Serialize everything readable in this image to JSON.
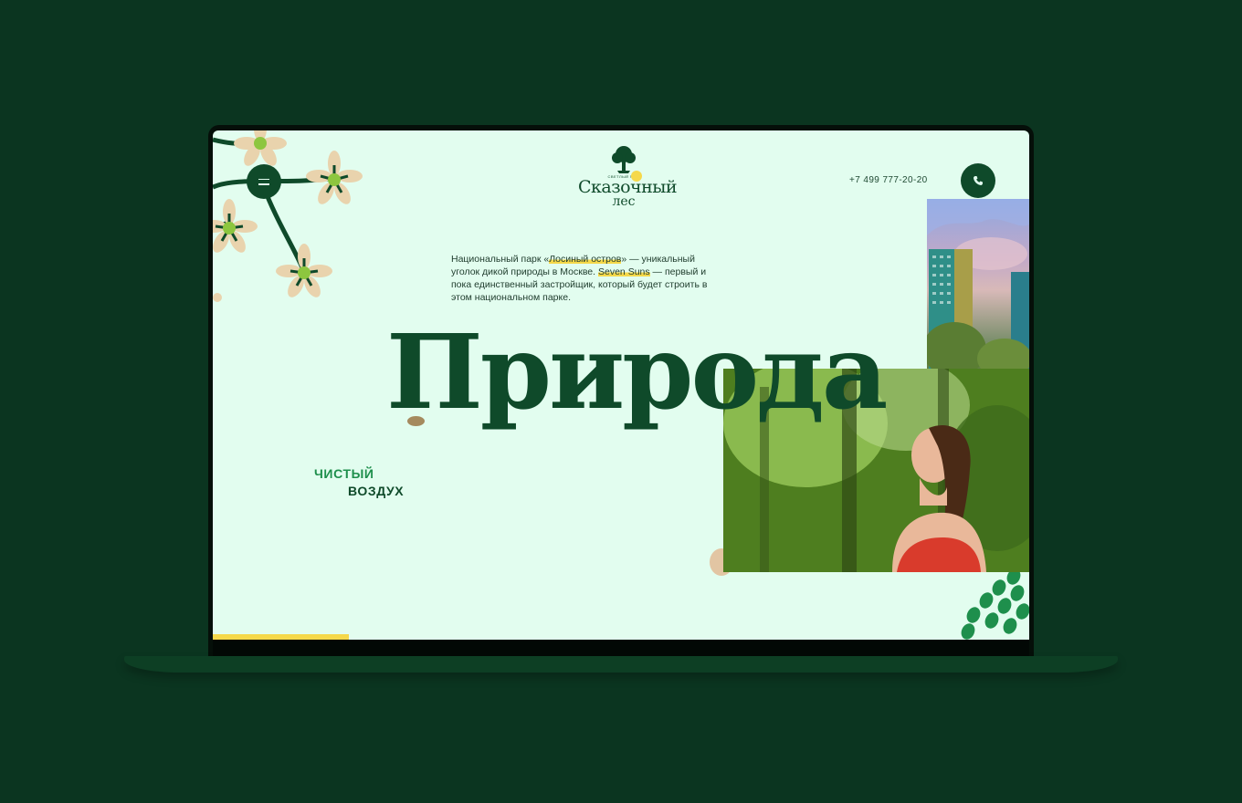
{
  "brand": {
    "logo_small": "СВЕТЛЫЙ МИР",
    "logo_main": "Сказочный",
    "logo_sub": "лес"
  },
  "header": {
    "phone": "+7 499 777-20-20"
  },
  "intro": {
    "part1": "Национальный парк «",
    "link1": "Лосиный остров",
    "part2": "» — уникальный уголок дикой природы в Москве. ",
    "link2": "Seven Suns",
    "part3": " — первый и пока единственный застройщик, который будет строить в этом национальном парке."
  },
  "hero": {
    "title": "Природа",
    "tag_line1": "ЧИСТЫЙ",
    "tag_line2": "ВОЗДУХ"
  },
  "progress": {
    "value_percent": 17
  },
  "colors": {
    "background": "#0b3520",
    "screen": "#e2fdef",
    "accent_dark": "#0f4a2a",
    "accent_green": "#1e8f4c",
    "highlight": "#f5d84a"
  },
  "icons": {
    "menu": "menu-icon",
    "phone": "phone-icon"
  }
}
